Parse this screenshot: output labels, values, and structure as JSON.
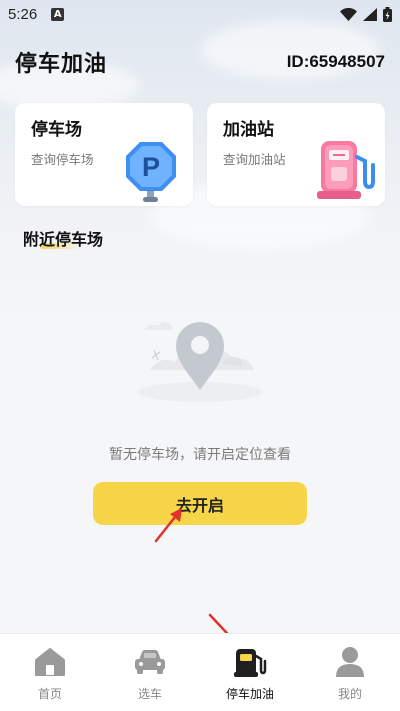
{
  "status": {
    "time": "5:26",
    "a_badge": "A"
  },
  "header": {
    "title": "停车加油",
    "user_id": "ID:65948507"
  },
  "cards": [
    {
      "title": "停车场",
      "subtitle": "查询停车场",
      "art_letter": "P"
    },
    {
      "title": "加油站",
      "subtitle": "查询加油站"
    }
  ],
  "section": {
    "title": "附近停车场"
  },
  "empty": {
    "message": "暂无停车场，请开启定位查看",
    "button_label": "去开启"
  },
  "tabs": [
    {
      "label": "首页",
      "icon": "home-icon"
    },
    {
      "label": "选车",
      "icon": "car-icon"
    },
    {
      "label": "停车加油",
      "icon": "fuel-pump-icon",
      "active": true
    },
    {
      "label": "我的",
      "icon": "user-icon"
    }
  ],
  "colors": {
    "accent_yellow": "#f6d648",
    "annotation_red": "#e0322d",
    "icon_gray": "#9a9a9a"
  }
}
